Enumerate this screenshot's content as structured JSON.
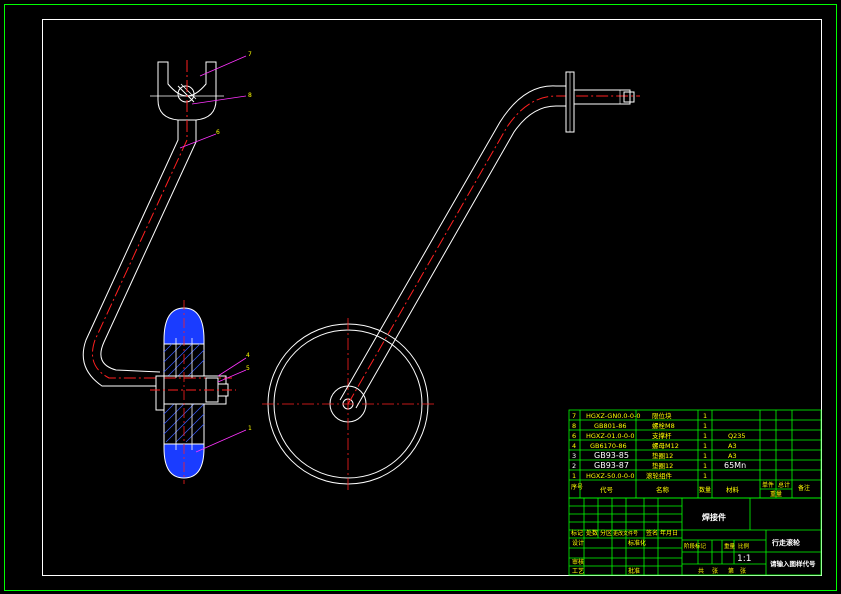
{
  "drawing": {
    "part_labels": [
      "7",
      "8",
      "6",
      "4",
      "5",
      "1"
    ],
    "title_block": {
      "name": "行走滚轮",
      "drawing_no": "请输入图样代号",
      "assembly": "焊接件",
      "scale": "1:1",
      "header": {
        "seq": "序号",
        "code": "代号",
        "name": "名称",
        "qty": "数量",
        "material": "材料",
        "unit_weight": "单件",
        "total_weight": "总计",
        "weight": "重量",
        "remark": "备注"
      },
      "bom": [
        {
          "seq": "7",
          "code": "HGXZ-GN0.0-0-0",
          "name": "限位块",
          "qty": "1",
          "material": ""
        },
        {
          "seq": "8",
          "code": "GB801-86",
          "name": "螺栓M8",
          "qty": "1",
          "material": ""
        },
        {
          "seq": "6",
          "code": "HGXZ-01.0-0-0",
          "name": "支撑杆",
          "qty": "1",
          "material": "Q235"
        },
        {
          "seq": "4",
          "code": "GB6170-86",
          "name": "螺母M12",
          "qty": "1",
          "material": "A3"
        },
        {
          "seq": "3",
          "code": "GB93-85",
          "name": "垫圈12",
          "qty": "1",
          "material": "A3"
        },
        {
          "seq": "2",
          "code": "GB93-87",
          "name": "垫圈12",
          "qty": "1",
          "material": "65Mn"
        },
        {
          "seq": "1",
          "code": "HGXZ-50.0-0-0",
          "name": "滚轮组件",
          "qty": "1",
          "material": ""
        }
      ],
      "rev_header": [
        "标记",
        "处数",
        "分区",
        "更改文件号",
        "签名",
        "年月日"
      ],
      "roles": [
        "设计",
        "审核",
        "工艺"
      ],
      "std_label": "标准化",
      "approve_label": "批准",
      "stage_header": [
        "阶段标记",
        "重量",
        "比例"
      ],
      "sheet_line": [
        "共",
        "张",
        "第",
        "张"
      ]
    }
  }
}
